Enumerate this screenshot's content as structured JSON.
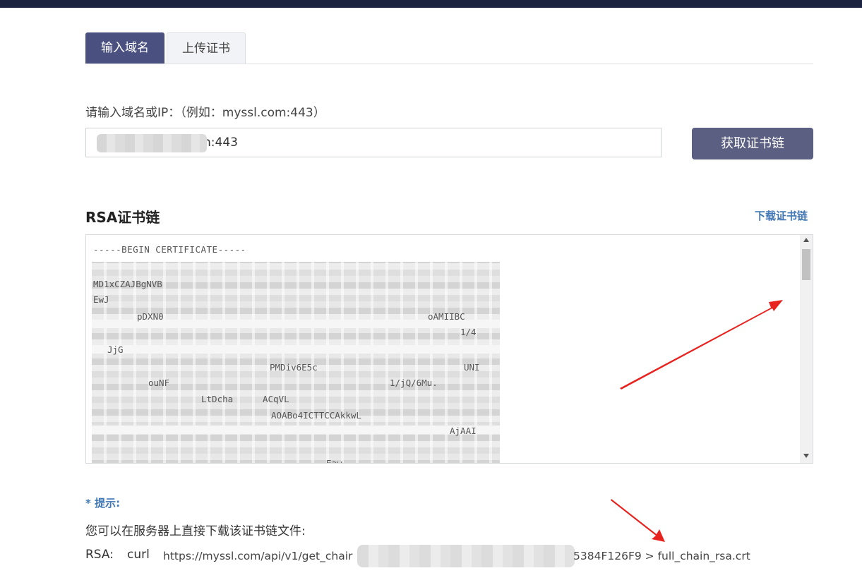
{
  "tabs": [
    {
      "label": "输入域名",
      "active": true
    },
    {
      "label": "上传证书",
      "active": false
    }
  ],
  "form": {
    "label": "请输入域名或IP：（例如：myssl.com:443）",
    "input_value": "n:443",
    "button_label": "获取证书链"
  },
  "rsa": {
    "title": "RSA证书链",
    "download_label": "下载证书链",
    "begin_line": "-----BEGIN CERTIFICATE-----",
    "fragments": [
      "MD1xCZAJBgNVB",
      "EwJ",
      "pDXN0",
      "oAMIIBC",
      "1/4",
      "JjG",
      "PMDiv6E5c",
      "UNI",
      "ouNF",
      "1/jQ/6Mu.",
      "LtDcha",
      "ACqVL",
      "AOABo4ICTTCCAkkwL",
      "AjAAI",
      "Eaw"
    ]
  },
  "tip": {
    "title": "* 提示:",
    "text": "您可以在服务器上直接下载该证书链文件:",
    "rsa_label": "RSA:",
    "curl_label": "curl",
    "url_start": "https://myssl.com/api/v1/get_chair",
    "url_end": "5384F126F9 > full_chain_rsa.crt"
  },
  "colors": {
    "accent": "#4a5180",
    "button": "#5b5f82",
    "link": "#3f76b3",
    "annotation_arrow": "#e8231f"
  }
}
